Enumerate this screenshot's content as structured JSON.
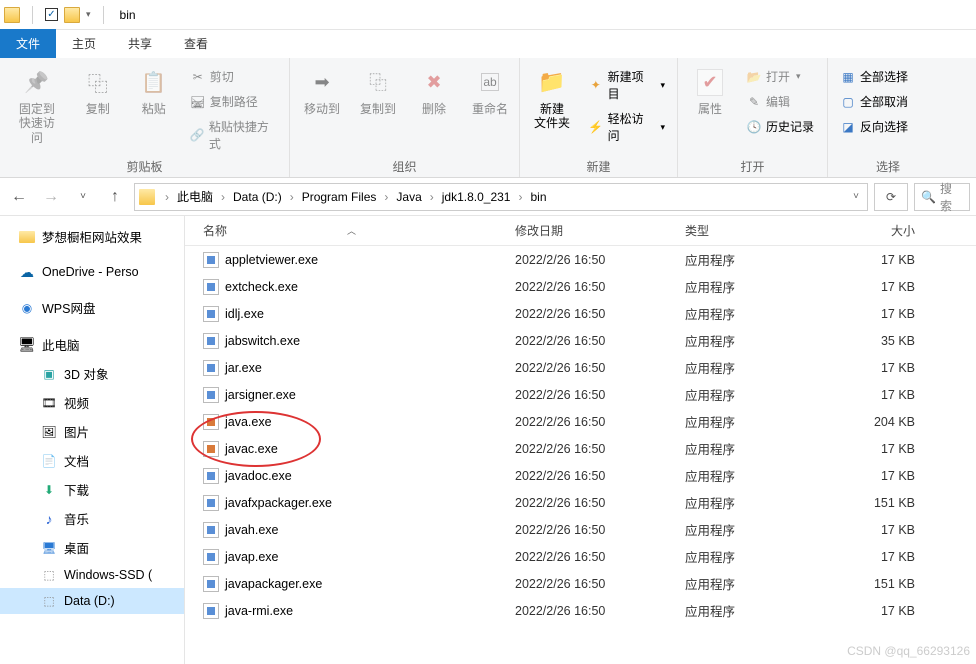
{
  "title": "bin",
  "tabs": {
    "file": "文件",
    "home": "主页",
    "share": "共享",
    "view": "查看"
  },
  "ribbon": {
    "clipboard": {
      "label": "剪贴板",
      "pin": "固定到\n快速访问",
      "copy": "复制",
      "paste": "粘贴",
      "cut": "剪切",
      "copypath": "复制路径",
      "pastelink": "粘贴快捷方式"
    },
    "organize": {
      "label": "组织",
      "moveto": "移动到",
      "copyto": "复制到",
      "delete": "删除",
      "rename": "重命名"
    },
    "new": {
      "label": "新建",
      "newfolder": "新建\n文件夹",
      "newitem": "新建项目",
      "easyaccess": "轻松访问"
    },
    "open": {
      "label": "打开",
      "props": "属性",
      "open": "打开",
      "edit": "编辑",
      "history": "历史记录"
    },
    "select": {
      "label": "选择",
      "all": "全部选择",
      "none": "全部取消",
      "invert": "反向选择"
    }
  },
  "breadcrumb": [
    "此电脑",
    "Data (D:)",
    "Program Files",
    "Java",
    "jdk1.8.0_231",
    "bin"
  ],
  "search_placeholder": "搜索",
  "nav": {
    "dream": "梦想橱柜网站效果",
    "onedrive": "OneDrive - Perso",
    "wps": "WPS网盘",
    "pc": "此电脑",
    "d3": "3D 对象",
    "video": "视频",
    "pic": "图片",
    "doc": "文档",
    "dl": "下载",
    "music": "音乐",
    "desktop": "桌面",
    "winssd": "Windows-SSD (",
    "datad": "Data (D:)"
  },
  "columns": {
    "name": "名称",
    "date": "修改日期",
    "type": "类型",
    "size": "大小"
  },
  "filetype": "应用程序",
  "files": [
    {
      "name": "appletviewer.exe",
      "date": "2022/2/26 16:50",
      "size": "17 KB",
      "icon": "exe"
    },
    {
      "name": "extcheck.exe",
      "date": "2022/2/26 16:50",
      "size": "17 KB",
      "icon": "exe"
    },
    {
      "name": "idlj.exe",
      "date": "2022/2/26 16:50",
      "size": "17 KB",
      "icon": "exe"
    },
    {
      "name": "jabswitch.exe",
      "date": "2022/2/26 16:50",
      "size": "35 KB",
      "icon": "exe"
    },
    {
      "name": "jar.exe",
      "date": "2022/2/26 16:50",
      "size": "17 KB",
      "icon": "exe"
    },
    {
      "name": "jarsigner.exe",
      "date": "2022/2/26 16:50",
      "size": "17 KB",
      "icon": "exe"
    },
    {
      "name": "java.exe",
      "date": "2022/2/26 16:50",
      "size": "204 KB",
      "icon": "java"
    },
    {
      "name": "javac.exe",
      "date": "2022/2/26 16:50",
      "size": "17 KB",
      "icon": "java"
    },
    {
      "name": "javadoc.exe",
      "date": "2022/2/26 16:50",
      "size": "17 KB",
      "icon": "exe"
    },
    {
      "name": "javafxpackager.exe",
      "date": "2022/2/26 16:50",
      "size": "151 KB",
      "icon": "exe"
    },
    {
      "name": "javah.exe",
      "date": "2022/2/26 16:50",
      "size": "17 KB",
      "icon": "exe"
    },
    {
      "name": "javap.exe",
      "date": "2022/2/26 16:50",
      "size": "17 KB",
      "icon": "exe"
    },
    {
      "name": "javapackager.exe",
      "date": "2022/2/26 16:50",
      "size": "151 KB",
      "icon": "exe"
    },
    {
      "name": "java-rmi.exe",
      "date": "2022/2/26 16:50",
      "size": "17 KB",
      "icon": "exe"
    }
  ],
  "watermark": "CSDN @qq_66293126"
}
